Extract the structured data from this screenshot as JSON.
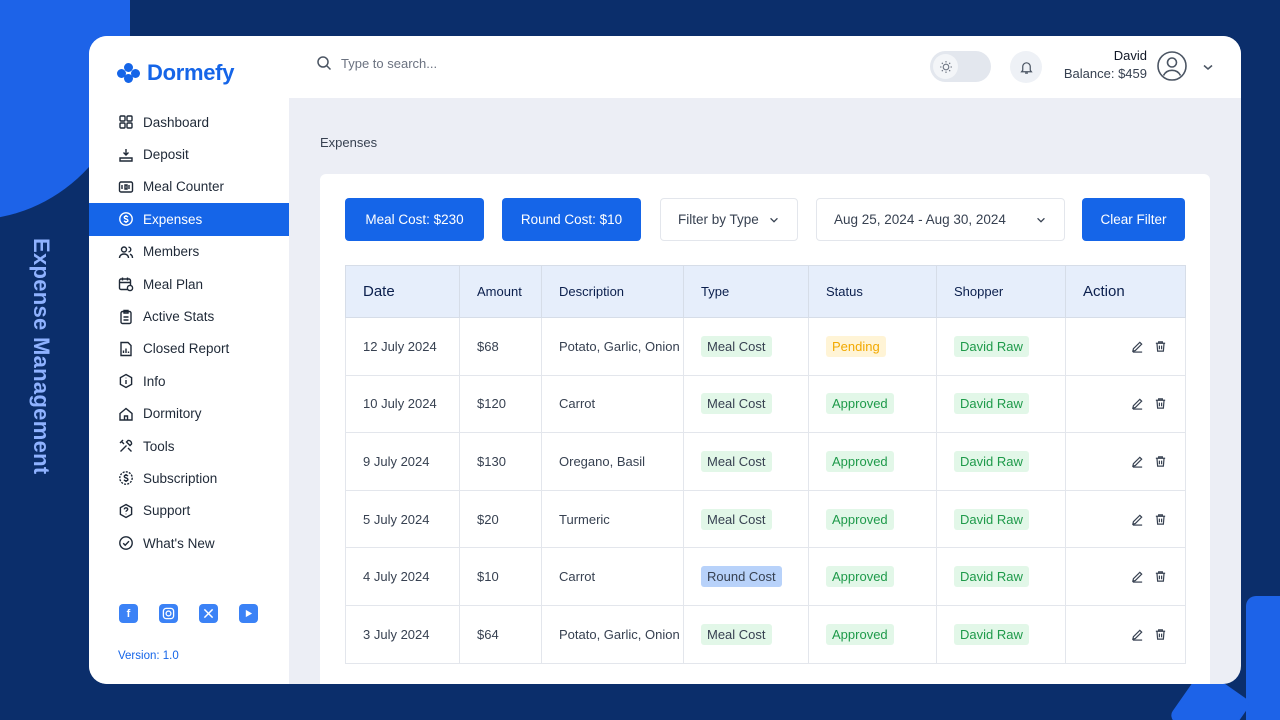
{
  "side_caption": "Expense Management",
  "app": {
    "name": "Dormefy",
    "version": "Version: 1.0"
  },
  "sidebar": {
    "items": [
      {
        "label": "Dashboard",
        "icon": "grid-icon"
      },
      {
        "label": "Deposit",
        "icon": "deposit-icon"
      },
      {
        "label": "Meal Counter",
        "icon": "counter-icon"
      },
      {
        "label": "Expenses",
        "icon": "expenses-icon",
        "active": true
      },
      {
        "label": "Members",
        "icon": "members-icon"
      },
      {
        "label": "Meal Plan",
        "icon": "calendar-icon"
      },
      {
        "label": "Active Stats",
        "icon": "clipboard-icon"
      },
      {
        "label": "Closed Report",
        "icon": "report-icon"
      },
      {
        "label": "Info",
        "icon": "info-icon"
      },
      {
        "label": "Dormitory",
        "icon": "home-icon"
      },
      {
        "label": "Tools",
        "icon": "tools-icon"
      },
      {
        "label": "Subscription",
        "icon": "dollar-icon"
      },
      {
        "label": "Support",
        "icon": "support-icon"
      },
      {
        "label": "What's New",
        "icon": "check-circle-icon"
      }
    ],
    "socials": [
      "facebook-icon",
      "instagram-icon",
      "x-icon",
      "youtube-icon"
    ]
  },
  "header": {
    "search_placeholder": "Type to search...",
    "user_name": "David",
    "balance": "Balance: $459"
  },
  "page_title": "Expenses",
  "filters": {
    "meal_cost": "Meal Cost:  $230",
    "round_cost": "Round Cost:  $10",
    "type_select": "Filter by Type",
    "date_range": "Aug 25, 2024 - Aug 30, 2024",
    "clear": "Clear Filter"
  },
  "table": {
    "columns": [
      "Date",
      "Amount",
      "Description",
      "Type",
      "Status",
      "Shopper",
      "Action"
    ],
    "rows": [
      {
        "date": "12 July 2024",
        "amount": "$68",
        "description": "Potato, Garlic, Onion",
        "type": "Meal Cost",
        "status": "Pending",
        "shopper": "David Raw"
      },
      {
        "date": "10 July 2024",
        "amount": "$120",
        "description": "Carrot",
        "type": "Meal Cost",
        "status": "Approved",
        "shopper": "David Raw"
      },
      {
        "date": "9 July 2024",
        "amount": "$130",
        "description": "Oregano, Basil",
        "type": "Meal Cost",
        "status": "Approved",
        "shopper": "David Raw"
      },
      {
        "date": "5 July 2024",
        "amount": "$20",
        "description": "Turmeric",
        "type": "Meal Cost",
        "status": "Approved",
        "shopper": "David Raw"
      },
      {
        "date": "4 July 2024",
        "amount": "$10",
        "description": "Carrot",
        "type": "Round Cost",
        "status": "Approved",
        "shopper": "David Raw"
      },
      {
        "date": "3 July 2024",
        "amount": "$64",
        "description": "Potato, Garlic, Onion",
        "type": "Meal Cost",
        "status": "Approved",
        "shopper": "David Raw"
      }
    ]
  },
  "colors": {
    "primary": "#1565e8",
    "background": "#0b2e6b",
    "approved": "#1e9a4a",
    "pending": "#f2a900"
  }
}
